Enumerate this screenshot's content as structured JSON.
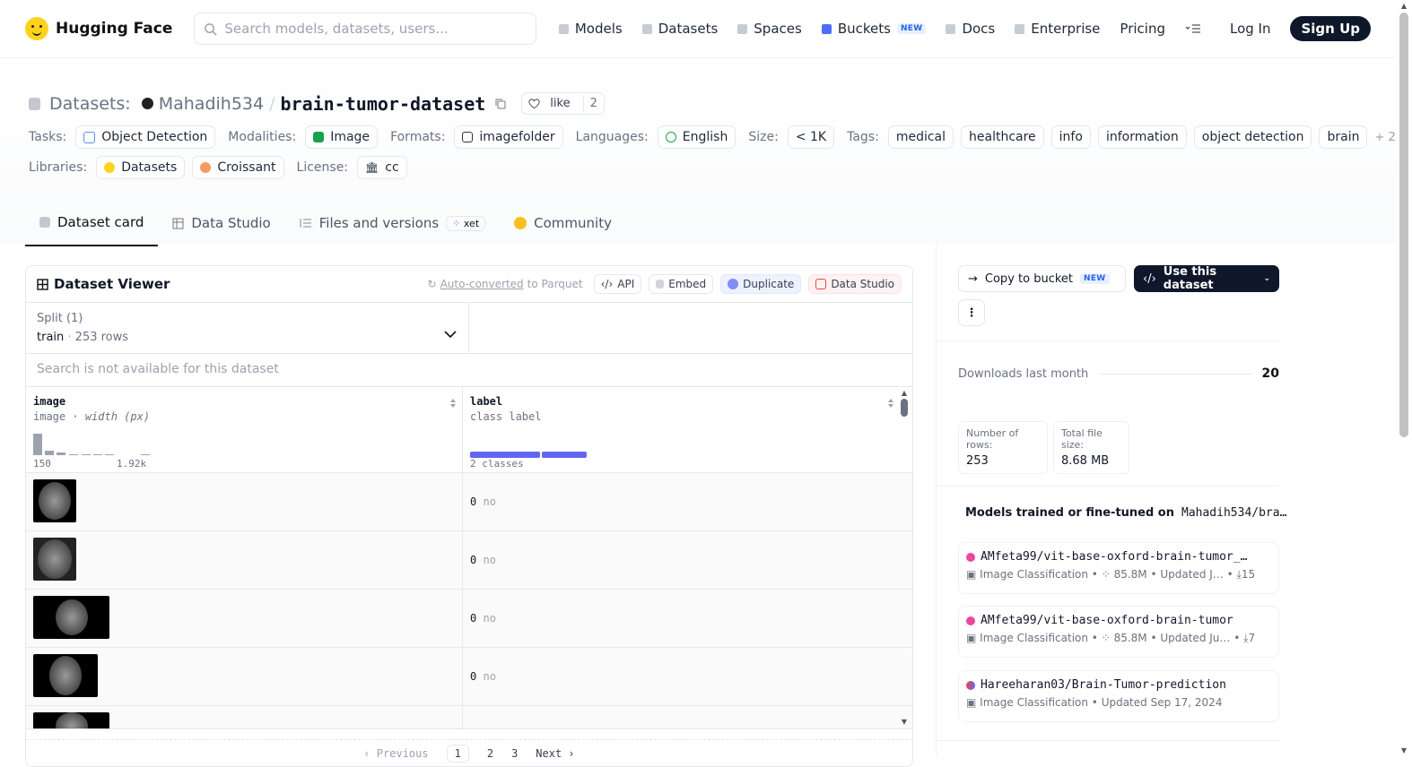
{
  "header": {
    "logo_text": "Hugging Face",
    "search_placeholder": "Search models, datasets, users...",
    "nav": [
      "Models",
      "Datasets",
      "Spaces",
      "Buckets",
      "Docs",
      "Enterprise",
      "Pricing"
    ],
    "new_badge": "NEW",
    "login": "Log In",
    "signup": "Sign Up"
  },
  "dataset": {
    "prefix": "Datasets:",
    "owner": "Mahadih534",
    "separator": "/",
    "name": "brain-tumor-dataset",
    "like_label": "like",
    "like_count": "2"
  },
  "tags": {
    "tasks_label": "Tasks:",
    "task": "Object Detection",
    "modalities_label": "Modalities:",
    "modality": "Image",
    "formats_label": "Formats:",
    "format": "imagefolder",
    "languages_label": "Languages:",
    "language": "English",
    "size_label": "Size:",
    "size": "< 1K",
    "tags_label": "Tags:",
    "tag_list": [
      "medical",
      "healthcare",
      "info",
      "information",
      "object detection",
      "brain"
    ],
    "more": "+ 2",
    "libraries_label": "Libraries:",
    "library1": "Datasets",
    "library2": "Croissant",
    "license_label": "License:",
    "license": "cc"
  },
  "tabs": {
    "card": "Dataset card",
    "studio": "Data Studio",
    "files": "Files and versions",
    "xet": "xet",
    "community": "Community"
  },
  "viewer": {
    "title": "Dataset Viewer",
    "auto_link": "Auto-converted",
    "auto_rest": "to Parquet",
    "api": "API",
    "embed": "Embed",
    "duplicate": "Duplicate",
    "data_studio": "Data Studio",
    "split_label": "Split (1)",
    "split_name": "train",
    "split_rows": "253 rows",
    "search_na": "Search is not available for this dataset",
    "col1": {
      "name": "image",
      "type": "image",
      "sub": "width (px)",
      "min": "150",
      "max": "1.92k"
    },
    "col2": {
      "name": "label",
      "type": "class label",
      "classes": "2 classes"
    },
    "rows": [
      {
        "label_id": "0",
        "label": "no"
      },
      {
        "label_id": "0",
        "label": "no"
      },
      {
        "label_id": "0",
        "label": "no"
      },
      {
        "label_id": "0",
        "label": "no"
      }
    ],
    "pager": {
      "prev": "Previous",
      "pages": [
        "1",
        "2",
        "3"
      ],
      "next": "Next"
    }
  },
  "sidebar": {
    "copy_bucket": "Copy to bucket",
    "new_badge": "NEW",
    "use_dataset": "Use this dataset",
    "downloads_label": "Downloads last month",
    "downloads": "20",
    "rows_label": "Number of rows:",
    "rows": "253",
    "size_label": "Total file size:",
    "size": "8.68 MB",
    "models_title": "Models trained or fine-tuned on",
    "models_ref": "Mahadih534/bra…",
    "models": [
      {
        "name": "AMfeta99/vit-base-oxford-brain-tumor_…",
        "task": "Image Classification",
        "params": "85.8M",
        "updated": "Updated J…",
        "downloads": "15",
        "color": "#ec4899"
      },
      {
        "name": "AMfeta99/vit-base-oxford-brain-tumor",
        "task": "Image Classification",
        "params": "85.8M",
        "updated": "Updated Ju…",
        "downloads": "7",
        "color": "#ec4899"
      },
      {
        "name": "Hareeharan03/Brain-Tumor-prediction",
        "task": "Image Classification",
        "updated": "Updated Sep 17, 2024",
        "color": "#6366f1"
      }
    ]
  }
}
